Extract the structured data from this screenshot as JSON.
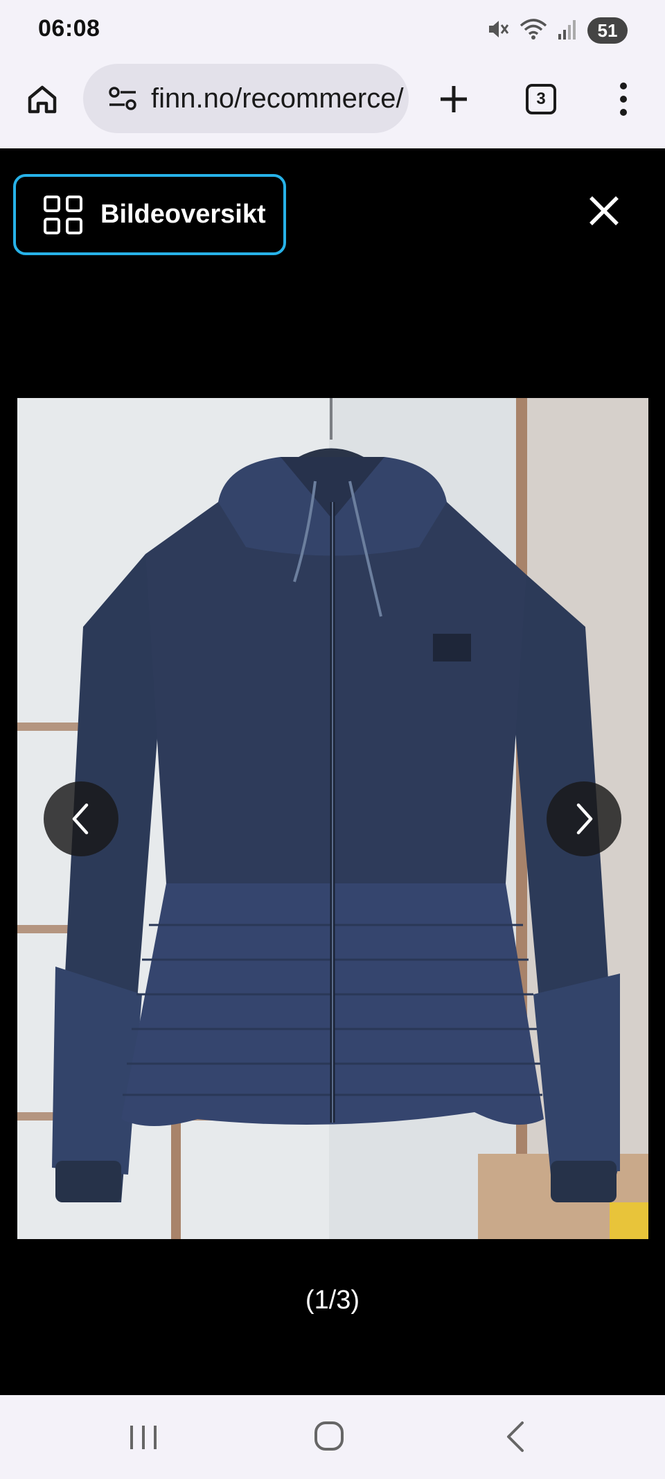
{
  "status_bar": {
    "time": "06:08",
    "battery": "51",
    "icons": [
      "mute-icon",
      "wifi-icon",
      "signal-icon",
      "battery-icon"
    ]
  },
  "browser": {
    "url": "finn.no/recommerce/",
    "tab_count": "3",
    "icons": [
      "home-icon",
      "site-settings-icon",
      "new-tab-icon",
      "tab-switcher-icon",
      "more-icon"
    ]
  },
  "viewer": {
    "overview_label": "Bildeoversikt",
    "counter": "(1/3)",
    "image_subject": "navy-hooded-jacket-photo",
    "accent_color": "#27b2e8"
  },
  "system_nav": {
    "icons": [
      "recent-apps-icon",
      "home-icon",
      "back-icon"
    ]
  }
}
